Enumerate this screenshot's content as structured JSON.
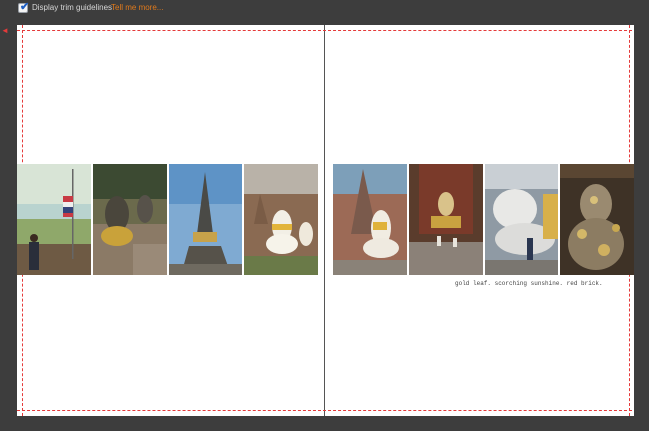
{
  "toolbar": {
    "checkbox_checked": true,
    "checkbox_label": "Display trim guidelines",
    "help_link": "Tell me more..."
  },
  "spread": {
    "caption": "gold leaf. scorching sunshine. red brick.",
    "left_photos": [
      {
        "subject": "thai-flag-on-temple-wall"
      },
      {
        "subject": "buddha-statue-row"
      },
      {
        "subject": "stupa-against-blue-sky"
      },
      {
        "subject": "white-buddha-statues"
      }
    ],
    "right_photos": [
      {
        "subject": "white-buddha-before-chedi"
      },
      {
        "subject": "temple-interior-shrine"
      },
      {
        "subject": "reclining-buddha"
      },
      {
        "subject": "gold-leaf-covered-statue"
      }
    ]
  },
  "colors": {
    "workspace": "#3d3d3d",
    "page": "#ffffff",
    "trim_line": "#e53a3a",
    "link": "#e07a1c"
  }
}
